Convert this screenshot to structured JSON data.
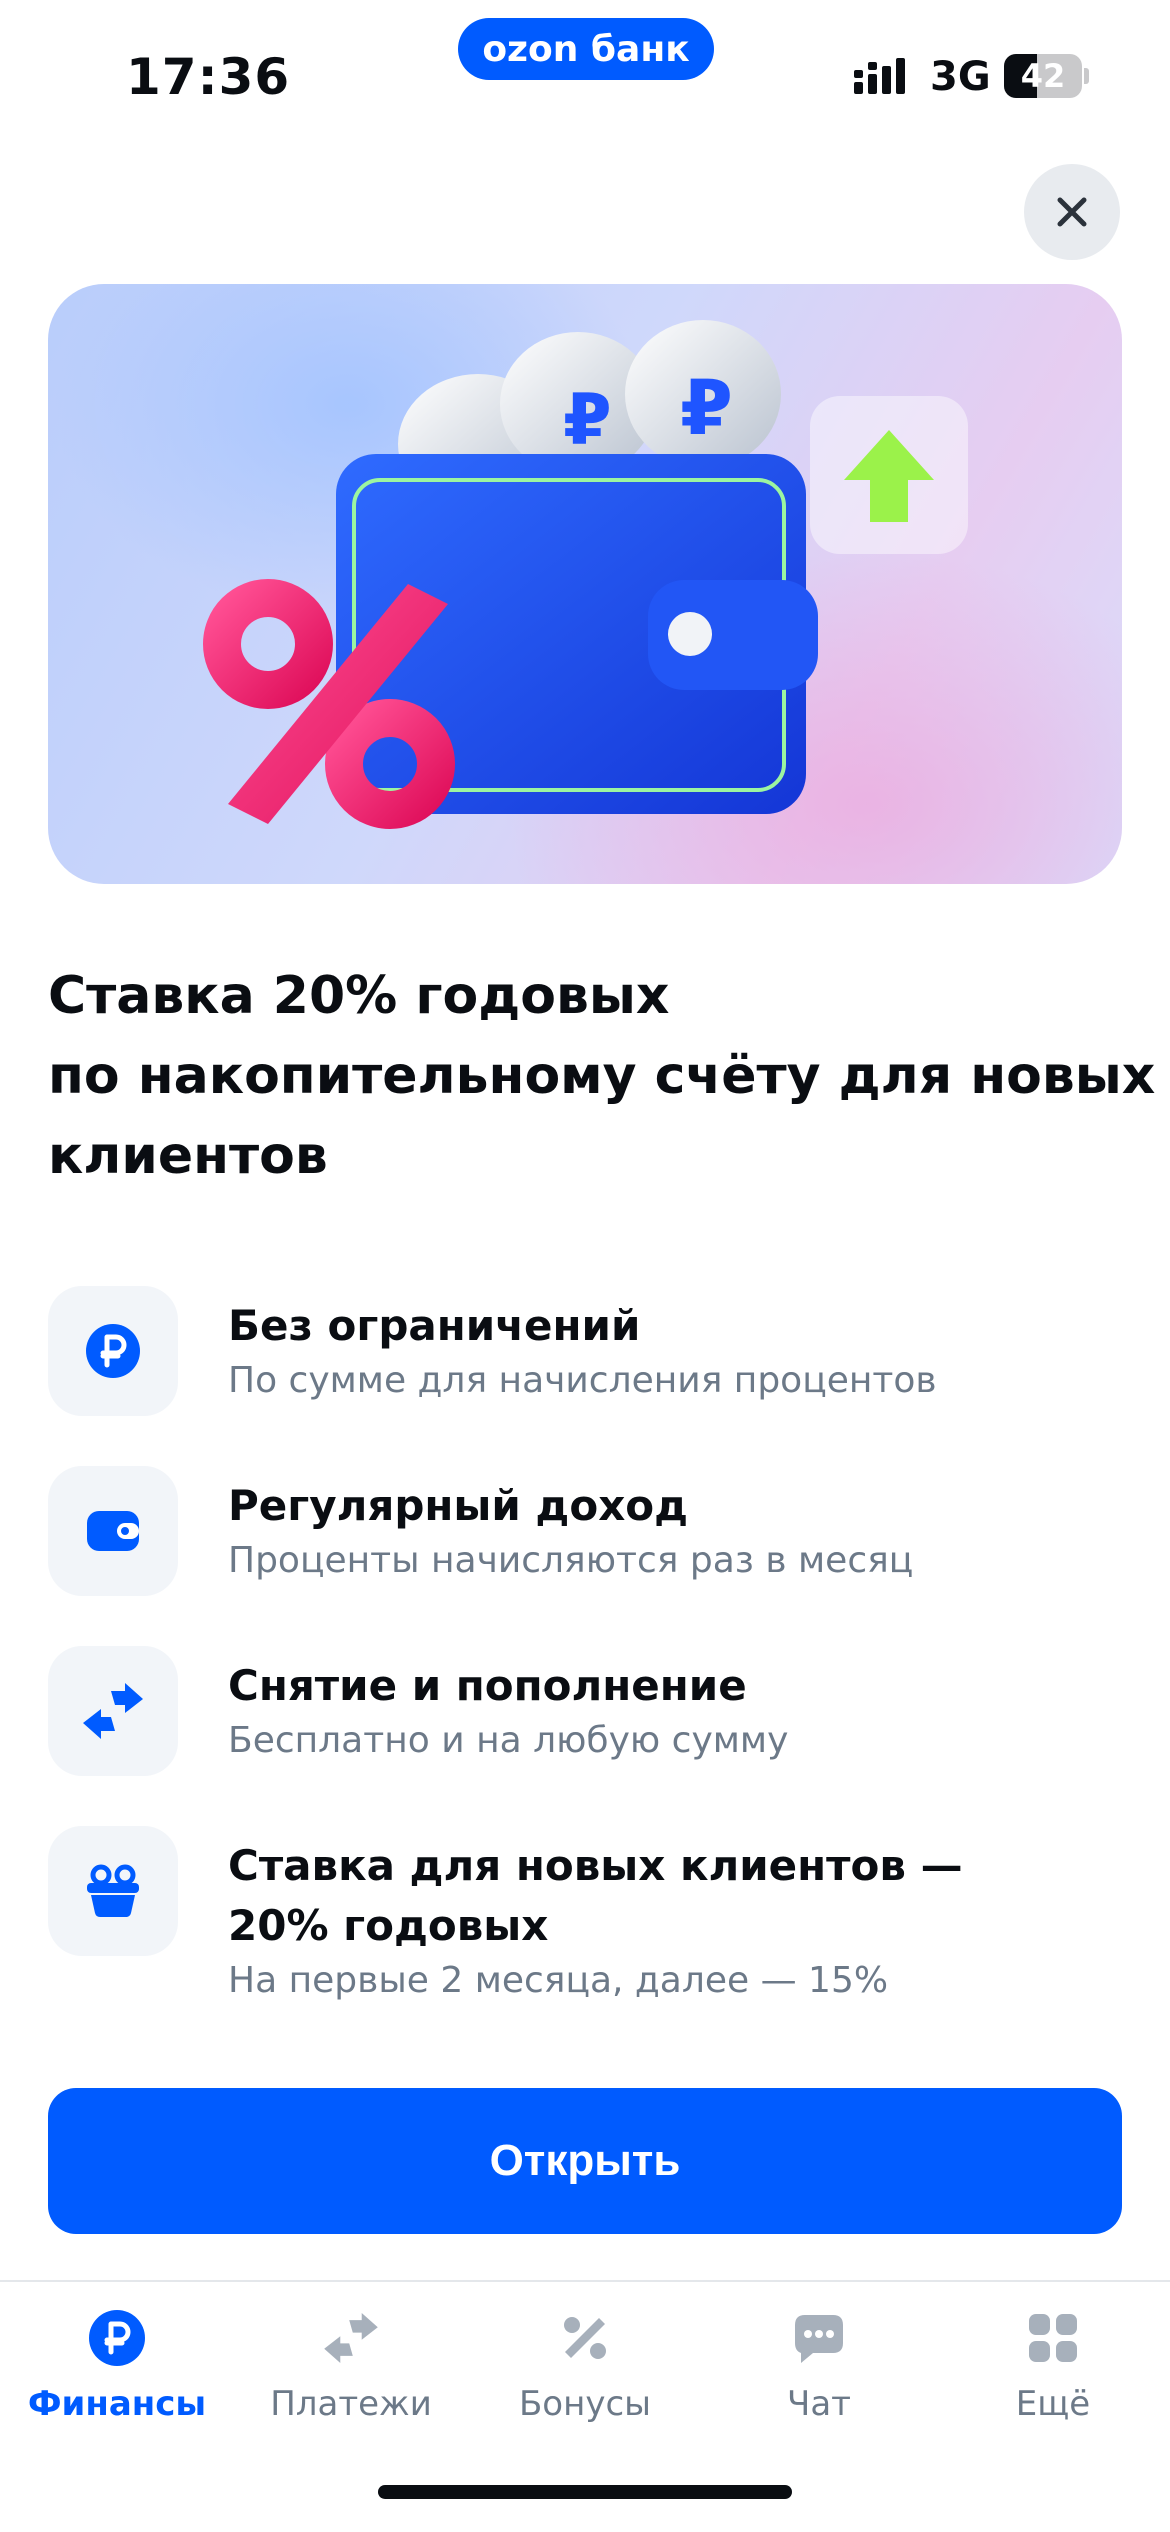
{
  "status_bar": {
    "time": "17:36",
    "brand": "ozon банк",
    "network": "3G",
    "battery_level": 42,
    "battery_label": "42"
  },
  "close": {
    "icon": "close-icon"
  },
  "hero": {
    "illustration": [
      "wallet-icon",
      "ruble-coin-icon",
      "percent-icon",
      "arrow-up-icon"
    ]
  },
  "headline": {
    "line1": "Ставка 20% годовых",
    "line2": "по накопительному счёту для новых",
    "line3": "клиентов"
  },
  "features": [
    {
      "icon": "ruble-icon",
      "title": "Без ограничений",
      "subtitle": "По сумме для начисления процентов"
    },
    {
      "icon": "wallet-icon",
      "title": "Регулярный доход",
      "subtitle": "Проценты начисляются раз в месяц"
    },
    {
      "icon": "transfer-arrows-icon",
      "title": "Снятие и пополнение",
      "subtitle": "Бесплатно и на любую сумму"
    },
    {
      "icon": "basket-icon",
      "title_line1": "Ставка для новых клиентов —",
      "title_line2": "20% годовых",
      "subtitle": "На первые 2 месяца, далее — 15%"
    }
  ],
  "cta": {
    "label": "Открыть"
  },
  "tabs": [
    {
      "label": "Финансы",
      "icon": "ruble-icon",
      "active": true
    },
    {
      "label": "Платежи",
      "icon": "transfer-arrows-icon",
      "active": false
    },
    {
      "label": "Бонусы",
      "icon": "percent-icon",
      "active": false
    },
    {
      "label": "Чат",
      "icon": "chat-icon",
      "active": false
    },
    {
      "label": "Ещё",
      "icon": "grid-icon",
      "active": false
    }
  ],
  "colors": {
    "accent": "#005bff",
    "text_primary": "#0a0d12",
    "text_secondary": "#6c7988",
    "icon_bg": "#f2f5f9",
    "tab_inactive": "#a7b0bb",
    "percent_pink": "#ff2d7a",
    "arrow_green": "#9bf24a"
  }
}
